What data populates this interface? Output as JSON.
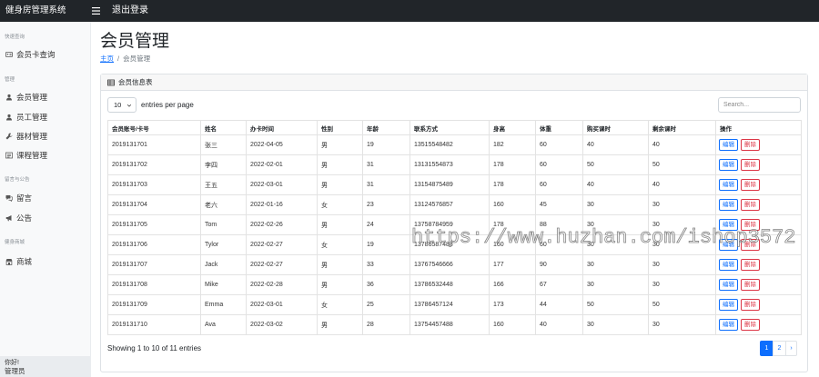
{
  "topbar": {
    "brand": "健身房管理系统",
    "logout": "退出登录",
    "menu_icon": "bars-icon"
  },
  "sidebar": {
    "sections": [
      {
        "heading": "快速查询",
        "items": [
          {
            "label": "会员卡查询",
            "icon": "id-card-icon"
          }
        ]
      },
      {
        "heading": "管理",
        "items": [
          {
            "label": "会员管理",
            "icon": "user-icon"
          },
          {
            "label": "员工管理",
            "icon": "user-icon"
          },
          {
            "label": "器材管理",
            "icon": "tools-icon"
          },
          {
            "label": "课程管理",
            "icon": "list-icon"
          }
        ]
      },
      {
        "heading": "留言与公告",
        "items": [
          {
            "label": "留言",
            "icon": "comments-icon"
          },
          {
            "label": "公告",
            "icon": "bullhorn-icon"
          }
        ]
      },
      {
        "heading": "健身商城",
        "items": [
          {
            "label": "商城",
            "icon": "store-icon"
          }
        ]
      }
    ],
    "footer": {
      "greeting": "你好!",
      "role": "管理员"
    }
  },
  "page": {
    "title": "会员管理",
    "breadcrumb": {
      "home": "主页",
      "separator": "/",
      "current": "会员管理"
    }
  },
  "card": {
    "title": "会员信息表",
    "icon": "table-icon"
  },
  "datatable": {
    "page_size": "10",
    "page_size_label": "entries per page",
    "search_placeholder": "Search...",
    "columns": [
      "会员账号/卡号",
      "姓名",
      "办卡时间",
      "性别",
      "年龄",
      "联系方式",
      "身高",
      "体重",
      "购买课时",
      "剩余课时",
      "操作"
    ],
    "rows": [
      [
        "2019131701",
        "张三",
        "2022-04-05",
        "男",
        "19",
        "13515548482",
        "182",
        "60",
        "40",
        "40"
      ],
      [
        "2019131702",
        "李四",
        "2022-02-01",
        "男",
        "31",
        "13131554873",
        "178",
        "60",
        "50",
        "50"
      ],
      [
        "2019131703",
        "王五",
        "2022-03-01",
        "男",
        "31",
        "13154875489",
        "178",
        "60",
        "40",
        "40"
      ],
      [
        "2019131704",
        "老六",
        "2022-01-16",
        "女",
        "23",
        "13124576857",
        "160",
        "45",
        "30",
        "30"
      ],
      [
        "2019131705",
        "Tom",
        "2022-02-26",
        "男",
        "24",
        "13758784959",
        "178",
        "88",
        "30",
        "30"
      ],
      [
        "2019131706",
        "Tylor",
        "2022-02-27",
        "女",
        "19",
        "13786587488",
        "160",
        "60",
        "30",
        "30"
      ],
      [
        "2019131707",
        "Jack",
        "2022-02-27",
        "男",
        "33",
        "13767546666",
        "177",
        "90",
        "30",
        "30"
      ],
      [
        "2019131708",
        "Mike",
        "2022-02-28",
        "男",
        "36",
        "13786532448",
        "166",
        "67",
        "30",
        "30"
      ],
      [
        "2019131709",
        "Emma",
        "2022-03-01",
        "女",
        "25",
        "13786457124",
        "173",
        "44",
        "50",
        "50"
      ],
      [
        "2019131710",
        "Ava",
        "2022-03-02",
        "男",
        "28",
        "13754457488",
        "160",
        "40",
        "30",
        "30"
      ]
    ],
    "actions": {
      "edit": "编辑",
      "delete": "删除"
    },
    "info": "Showing 1 to 10 of 11 entries",
    "pagination": {
      "pages": [
        "1",
        "2"
      ],
      "current": "1",
      "next": "›"
    }
  },
  "watermark": "https://www.huzhan.com/ishop3572",
  "colors": {
    "topbar": "#212529",
    "primary": "#0d6efd",
    "danger": "#dc3545",
    "sidebar": "#f8f9fa"
  }
}
